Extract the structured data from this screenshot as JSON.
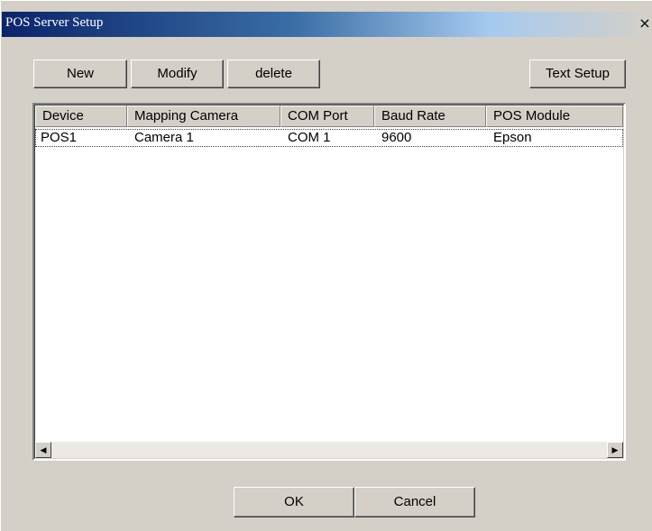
{
  "window": {
    "title": "POS Server Setup",
    "close_glyph": "×"
  },
  "toolbar": {
    "new_label": "New",
    "modify_label": "Modify",
    "delete_label": "delete",
    "text_setup_label": "Text Setup"
  },
  "table": {
    "columns": [
      "Device",
      "Mapping Camera",
      "COM Port",
      "Baud Rate",
      "POS Module"
    ],
    "rows": [
      [
        "POS1",
        "Camera 1",
        "COM 1",
        "9600",
        "Epson"
      ]
    ]
  },
  "scrollbar": {
    "left_glyph": "◀",
    "right_glyph": "▶"
  },
  "footer": {
    "ok_label": "OK",
    "cancel_label": "Cancel"
  }
}
